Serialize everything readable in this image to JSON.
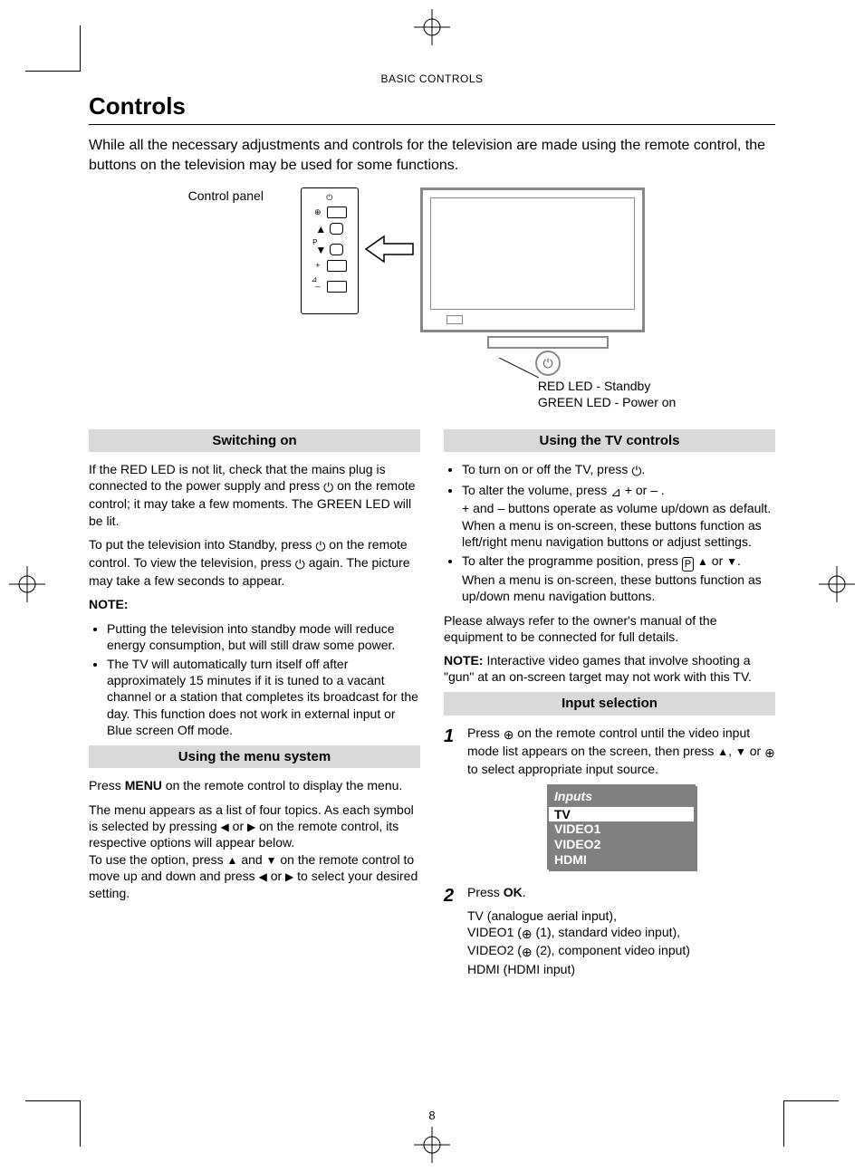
{
  "running_head": "BASIC CONTROLS",
  "title": "Controls",
  "intro": "While all the necessary adjustments and controls for the television are made using the remote control, the buttons on the television may be used for some functions.",
  "diagram": {
    "control_panel_label": "Control panel",
    "led_red": "RED LED - Standby",
    "led_green": "GREEN LED - Power on"
  },
  "left_col": {
    "switching_on": {
      "heading": "Switching on",
      "p1a": "If the RED LED is not lit, check that the mains plug is connected to the power supply and press ",
      "p1b": " on the remote control; it may take a few moments. The GREEN LED will be lit.",
      "p2a": "To put the television into Standby, press ",
      "p2b": " on the remote control. To view the television, press ",
      "p2c": " again. The picture may take a few seconds to appear.",
      "note_label": "NOTE:",
      "note1": "Putting the television into standby mode will reduce energy consumption, but will still draw some power.",
      "note2": "The TV will automatically turn itself off after approximately 15 minutes if it is tuned to a vacant channel or a station that completes its broadcast for the day. This function does not work in external input or Blue screen Off mode."
    },
    "menu_system": {
      "heading": "Using the menu system",
      "p1a": "Press ",
      "p1_menu": "MENU",
      "p1b": " on the remote control to display the menu.",
      "p2a": "The menu appears as a list of four topics. As each symbol is selected by pressing ",
      "p2_or": " or ",
      "p2b": " on the remote control, its respective options will appear below.",
      "p3a": "To use the option, press ",
      "p3_and": " and ",
      "p3b": " on the remote control to move up and down and press ",
      "p3_or": " or ",
      "p3c": " to select your desired setting."
    }
  },
  "right_col": {
    "tv_controls": {
      "heading": "Using the TV controls",
      "b1a": "To turn on or off the TV, press ",
      "b1b": ".",
      "b2a": "To alter the volume, press ",
      "b2_sym": " + or – .",
      "b2b": "+ and – buttons operate as volume up/down as default.",
      "b2c": "When a menu is on-screen, these buttons function as left/right menu navigation buttons or adjust settings.",
      "b3a": "To alter the programme position, press ",
      "b3_or": " or ",
      "b3b": ".",
      "b3c": "When a menu is on-screen, these buttons function as up/down menu navigation buttons.",
      "p_after": "Please always refer to the owner's manual of the equipment to be connected for full details.",
      "note_label": "NOTE:",
      "note_text": " Interactive video games that involve shooting a \"gun\" at an on-screen target may not work with this TV."
    },
    "input_selection": {
      "heading": "Input selection",
      "step1a": "Press ",
      "step1b": " on the remote control until the video input mode list appears on the screen, then press ",
      "step1_comma": ", ",
      "step1_or": " or ",
      "step1c": " to select appropriate input source.",
      "inputs_title": "Inputs",
      "inputs": [
        "TV",
        "VIDEO1",
        "VIDEO2",
        "HDMI"
      ],
      "step2a": "Press ",
      "step2_ok": "OK",
      "step2b": ".",
      "desc_tv": "TV (analogue aerial input),",
      "desc_v1a": "VIDEO1 (",
      "desc_v1b": " (1), standard video input),",
      "desc_v2a": "VIDEO2 (",
      "desc_v2b": " (2), component video input)",
      "desc_hdmi": "HDMI (HDMI input)"
    }
  },
  "page_number": "8"
}
